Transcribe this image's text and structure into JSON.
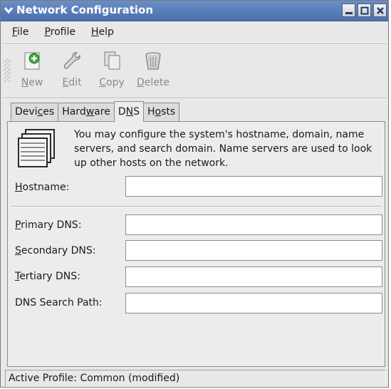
{
  "window": {
    "title": "Network Configuration"
  },
  "menubar": {
    "items": [
      {
        "u": "F",
        "rest": "ile"
      },
      {
        "u": "P",
        "rest": "rofile"
      },
      {
        "u": "H",
        "rest": "elp"
      }
    ]
  },
  "toolbar": {
    "new": {
      "u": "N",
      "rest": "ew",
      "icon": "new-icon"
    },
    "edit": {
      "u": "E",
      "rest": "dit",
      "icon": "wrench-icon"
    },
    "copy": {
      "u": "C",
      "rest": "opy",
      "icon": "copy-icon"
    },
    "delete": {
      "u": "D",
      "rest": "elete",
      "icon": "trash-icon"
    }
  },
  "tabs": {
    "devices": {
      "a": "Devi",
      "u": "c",
      "b": "es"
    },
    "hardware": {
      "a": "Hard",
      "u": "w",
      "b": "are"
    },
    "dns": {
      "a": "D",
      "u": "N",
      "b": "S"
    },
    "hosts": {
      "a": "H",
      "u": "o",
      "b": "sts"
    },
    "active": "DNS"
  },
  "dns": {
    "description": "You may configure the system's hostname, domain, name servers, and search domain. Name servers are used to look up other hosts on the network.",
    "hostname": {
      "u": "H",
      "rest": "ostname:",
      "value": ""
    },
    "primary": {
      "u": "P",
      "rest": "rimary DNS:",
      "value": ""
    },
    "secondary": {
      "u": "S",
      "rest": "econdary DNS:",
      "value": ""
    },
    "tertiary": {
      "u": "T",
      "rest": "ertiary DNS:",
      "value": ""
    },
    "search": {
      "label": "DNS Search Path:",
      "value": ""
    }
  },
  "status": {
    "text": "Active Profile: Common (modified)"
  },
  "colors": {
    "titlebar": "#4a6fae",
    "window_bg": "#e8e8e8",
    "add_green": "#3fa83f"
  }
}
